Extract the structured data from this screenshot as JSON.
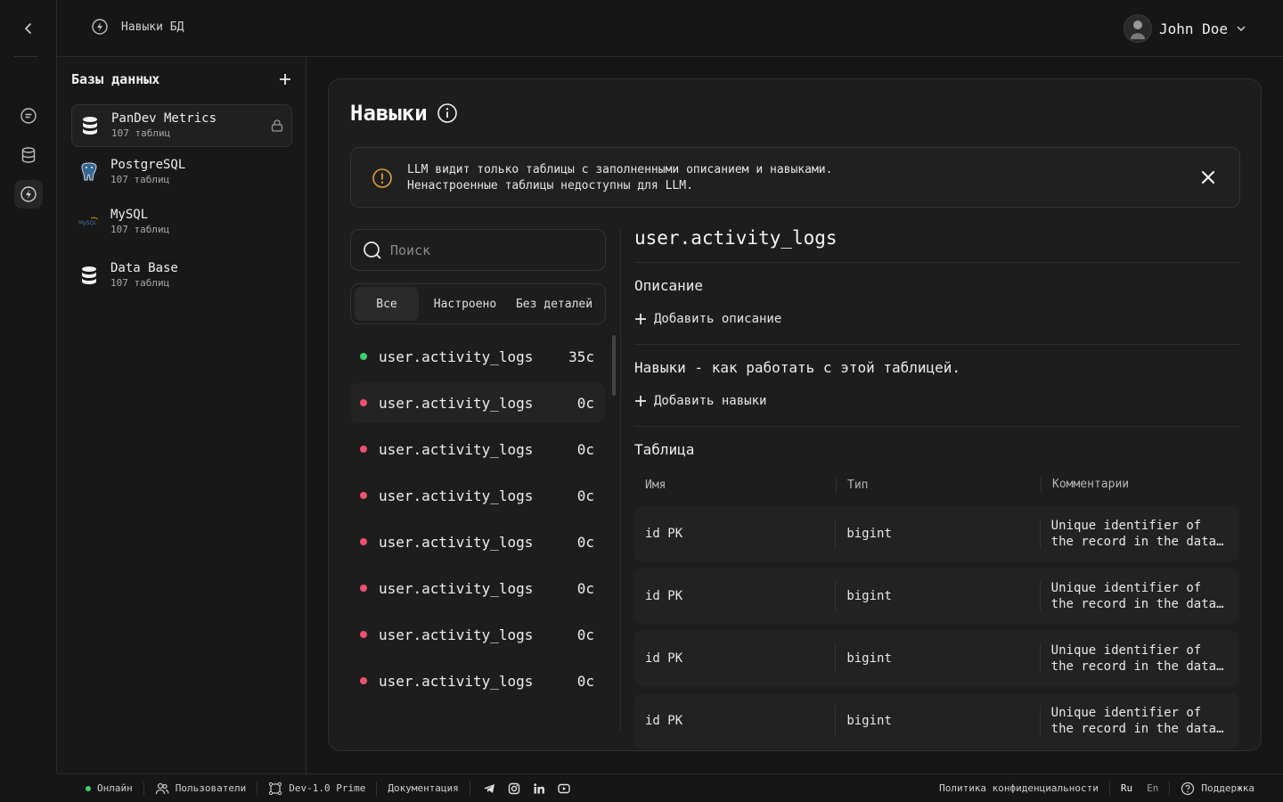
{
  "breadcrumb": {
    "label": "Навыки БД"
  },
  "user": {
    "name": "John Doe"
  },
  "databases": {
    "title": "Базы данных",
    "items": [
      {
        "name": "PanDev Metrics",
        "count": "107 таблиц"
      },
      {
        "name": "PostgreSQL",
        "count": "107 таблиц"
      },
      {
        "name": "MySQL",
        "count": "107 таблиц"
      },
      {
        "name": "Data Base",
        "count": "107 таблиц"
      }
    ]
  },
  "main": {
    "title": "Навыки",
    "notice": {
      "line1": "LLM видит только таблицы с заполненными описанием и навыками.",
      "line2": "Ненастроенные таблицы недоступны для LLM."
    },
    "search_placeholder": "Поиск",
    "filters": [
      "Все",
      "Настроено",
      "Без деталей"
    ],
    "tables": [
      {
        "name": "user.activity_logs",
        "count": "35с",
        "status": "configured"
      },
      {
        "name": "user.activity_logs",
        "count": "0с",
        "status": "empty"
      },
      {
        "name": "user.activity_logs",
        "count": "0с",
        "status": "empty"
      },
      {
        "name": "user.activity_logs",
        "count": "0с",
        "status": "empty"
      },
      {
        "name": "user.activity_logs",
        "count": "0с",
        "status": "empty"
      },
      {
        "name": "user.activity_logs",
        "count": "0с",
        "status": "empty"
      },
      {
        "name": "user.activity_logs",
        "count": "0с",
        "status": "empty"
      },
      {
        "name": "user.activity_logs",
        "count": "0с",
        "status": "empty"
      }
    ]
  },
  "detail": {
    "title": "user.activity_logs",
    "description_label": "Описание",
    "add_description": "Добавить описание",
    "skills_label": "Навыки - как работать с этой таблицей.",
    "add_skills": "Добавить навыки",
    "table_label": "Таблица",
    "columns": [
      "Имя",
      "Тип",
      "Комментарии"
    ],
    "rows": [
      {
        "name": "id PK",
        "type": "bigint",
        "comment1": "Unique identifier of",
        "comment2": "the record in the data…"
      },
      {
        "name": "id PK",
        "type": "bigint",
        "comment1": "Unique identifier of",
        "comment2": "the record in the data…"
      },
      {
        "name": "id PK",
        "type": "bigint",
        "comment1": "Unique identifier of",
        "comment2": "the record in the data…"
      },
      {
        "name": "id PK",
        "type": "bigint",
        "comment1": "Unique identifier of",
        "comment2": "the record in the data…"
      }
    ]
  },
  "footer": {
    "status": "Онлайн",
    "users": "Пользователи",
    "version": "Dev-1.0 Prime",
    "docs": "Документация",
    "privacy": "Политика конфиденциальности",
    "lang_ru": "Ru",
    "lang_en": "En",
    "support": "Поддержка"
  },
  "colors": {
    "configured": "#3fcf6f",
    "empty": "#f0506e",
    "warning": "#e0a030"
  }
}
